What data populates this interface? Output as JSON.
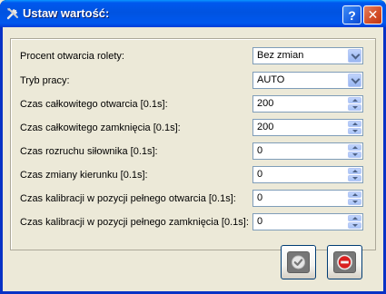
{
  "window": {
    "title": "Ustaw wartość:",
    "help_label": "?",
    "close_label": "✕"
  },
  "form": {
    "rows": [
      {
        "label": "Procent otwarcia rolety:",
        "value": "Bez zmian",
        "control": "dropdown"
      },
      {
        "label": "Tryb pracy:",
        "value": "AUTO",
        "control": "dropdown"
      },
      {
        "label": "Czas całkowitego otwarcia [0.1s]:",
        "value": "200",
        "control": "spinbox"
      },
      {
        "label": "Czas całkowitego zamknięcia [0.1s]:",
        "value": "200",
        "control": "spinbox"
      },
      {
        "label": "Czas rozruchu siłownika [0.1s]:",
        "value": "0",
        "control": "spinbox"
      },
      {
        "label": "Czas zmiany kierunku [0.1s]:",
        "value": "0",
        "control": "spinbox"
      },
      {
        "label": "Czas kalibracji w pozycji pełnego otwarcia [0.1s]:",
        "value": "0",
        "control": "spinbox"
      },
      {
        "label": "Czas kalibracji w pozycji pełnego zamknięcia [0.1s]:",
        "value": "0",
        "control": "spinbox"
      }
    ]
  },
  "buttons": {
    "ok_icon": "checkmark-icon",
    "cancel_icon": "no-entry-icon"
  },
  "colors": {
    "titlebar": "#0054e3",
    "dialog_bg": "#ece9d8",
    "input_border": "#7f9db9"
  }
}
